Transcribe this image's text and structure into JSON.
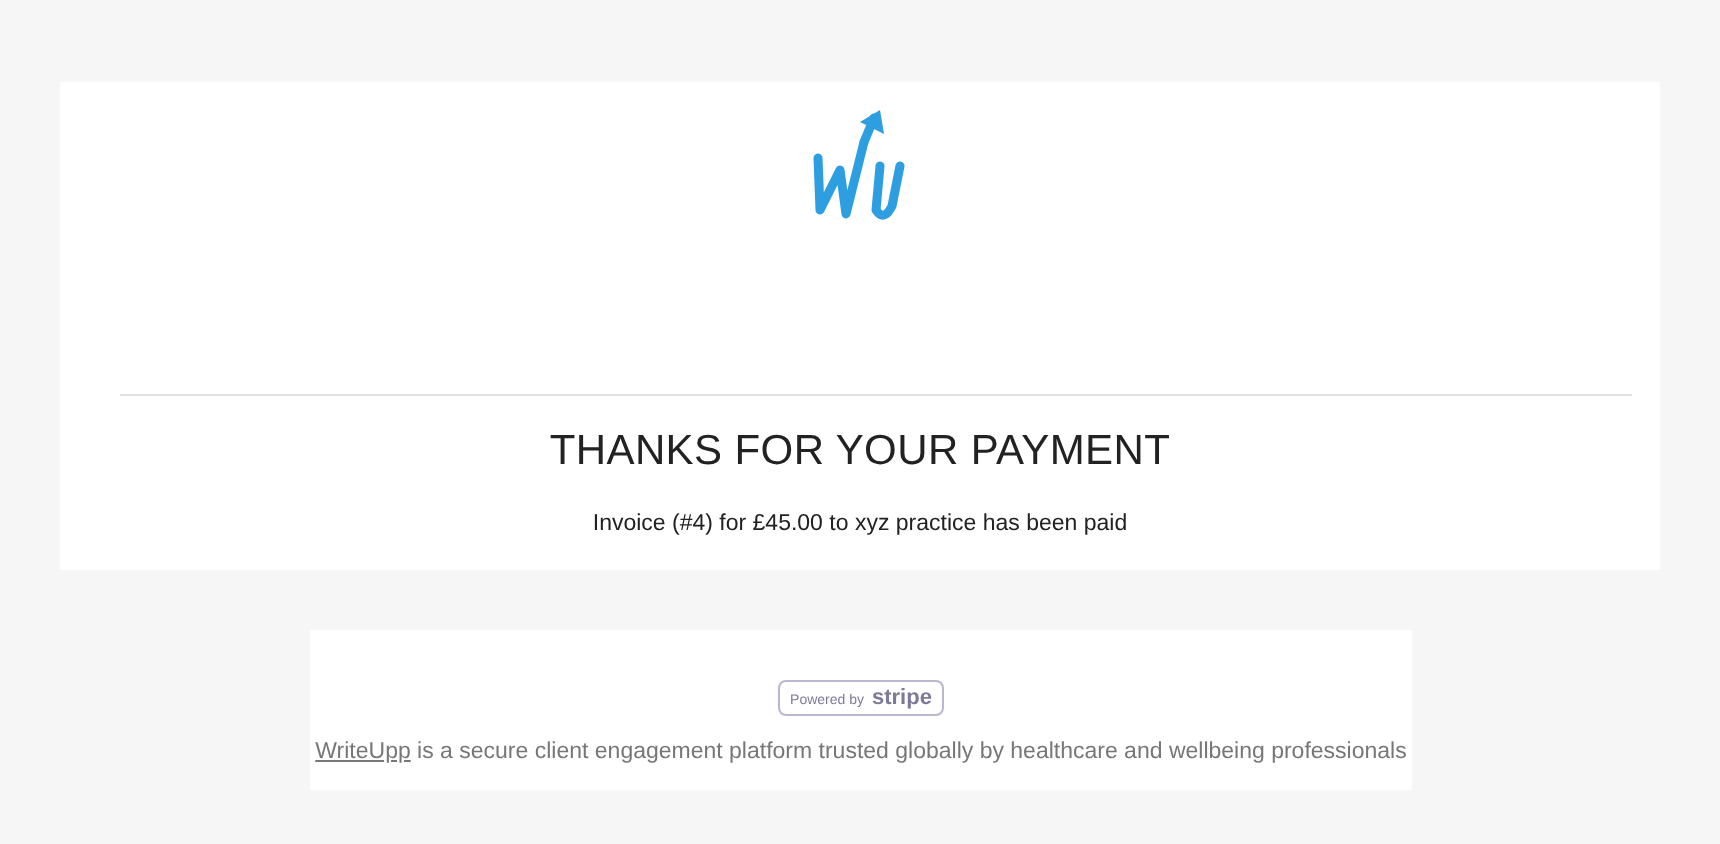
{
  "heading": "THANKS FOR YOUR PAYMENT",
  "message": "Invoice (#4) for £45.00 to xyz practice has been paid",
  "badge": {
    "prefix": "Powered by",
    "brand": "stripe"
  },
  "footer": {
    "link": "WriteUpp",
    "text": " is a secure client engagement platform trusted globally by healthcare and wellbeing professionals"
  }
}
